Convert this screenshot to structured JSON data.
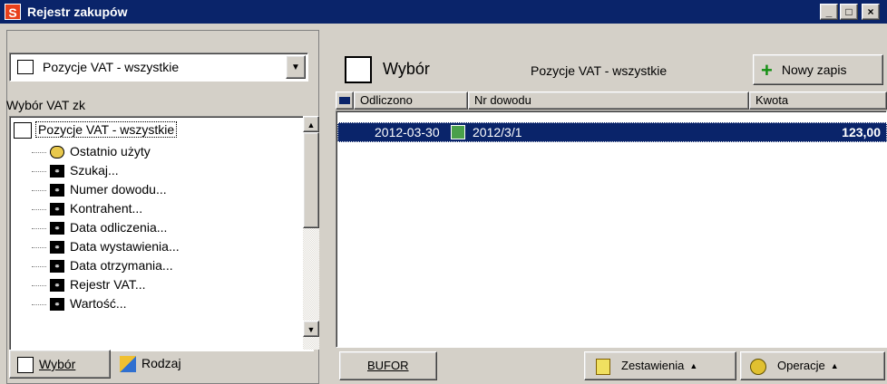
{
  "window": {
    "title": "Rejestr zakupów",
    "app_icon_letter": "S",
    "controls": {
      "minimize": "_",
      "maximize": "□",
      "close": "×"
    }
  },
  "left_panel": {
    "combo_value": "Pozycje VAT - wszystkie",
    "caption": "Wybór VAT zk",
    "tree": {
      "root": "Pozycje VAT - wszystkie",
      "items": [
        {
          "label": "Ostatnio użyty",
          "icon": "recent-icon"
        },
        {
          "label": "Szukaj...",
          "icon": "binoculars-icon"
        },
        {
          "label": "Numer dowodu...",
          "icon": "binoculars-icon"
        },
        {
          "label": "Kontrahent...",
          "icon": "binoculars-icon"
        },
        {
          "label": "Data odliczenia...",
          "icon": "binoculars-icon"
        },
        {
          "label": "Data wystawienia...",
          "icon": "binoculars-icon"
        },
        {
          "label": "Data otrzymania...",
          "icon": "binoculars-icon"
        },
        {
          "label": "Rejestr VAT...",
          "icon": "binoculars-icon"
        },
        {
          "label": "Wartość...",
          "icon": "binoculars-icon"
        }
      ]
    },
    "tabs": [
      {
        "label": "Wybór",
        "icon": "document-icon"
      },
      {
        "label": "Rodzaj",
        "icon": "shapes-icon"
      }
    ]
  },
  "right_panel": {
    "toolbar": {
      "wybor_label": "Wybór",
      "selection_title": "Pozycje VAT - wszystkie",
      "new_button": "Nowy zapis"
    },
    "table": {
      "columns": [
        "Odliczono",
        "Nr dowodu",
        "Kwota"
      ],
      "rows": [
        {
          "odliczono": "2012-03-30",
          "nr_dowodu": "2012/3/1",
          "kwota": "123,00"
        }
      ]
    },
    "bottom": {
      "bufor": "BUFOR",
      "zestawienia": "Zestawienia",
      "operacje": "Operacje"
    }
  },
  "colors": {
    "title_bar": "#0a246a",
    "face": "#d4d0c8",
    "selection": "#0a246a",
    "accent_green": "#149014"
  }
}
